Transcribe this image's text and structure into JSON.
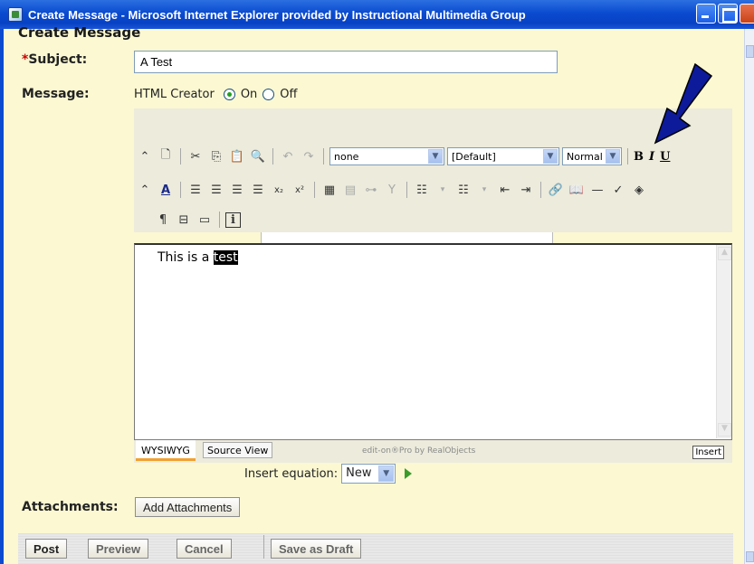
{
  "window": {
    "title": "Create Message - Microsoft Internet Explorer provided by Instructional Multimedia Group"
  },
  "page": {
    "heading": "Create Message"
  },
  "subject": {
    "required_mark": "*",
    "label": "Subject:",
    "value": "A Test"
  },
  "message": {
    "label": "Message:",
    "html_creator_label": "HTML Creator",
    "on_label": "On",
    "off_label": "Off",
    "selected": "On"
  },
  "toolbar": {
    "style_select": "none",
    "font_select": "[Default]",
    "size_select": "Normal",
    "bold": "B",
    "italic": "I",
    "underline": "U",
    "subscript": "x₂",
    "superscript": "x²",
    "info": "i"
  },
  "editor": {
    "text_before": "This is a ",
    "text_selected": "test",
    "tab_wysiwyg": "WYSIWYG",
    "tab_source": "Source View",
    "brand": "edit-on®Pro by RealObjects",
    "mode_indicator": "Insert"
  },
  "equation": {
    "label": "Insert equation:",
    "value": "New"
  },
  "attachments": {
    "label": "Attachments:",
    "button": "Add Attachments"
  },
  "actions": {
    "post": "Post",
    "preview": "Preview",
    "cancel": "Cancel",
    "save_draft": "Save as Draft"
  },
  "colors": {
    "page_bg": "#fbf8d2",
    "titlebar": "#0a4bd0",
    "annotation_arrow": "#0d1a9a"
  }
}
